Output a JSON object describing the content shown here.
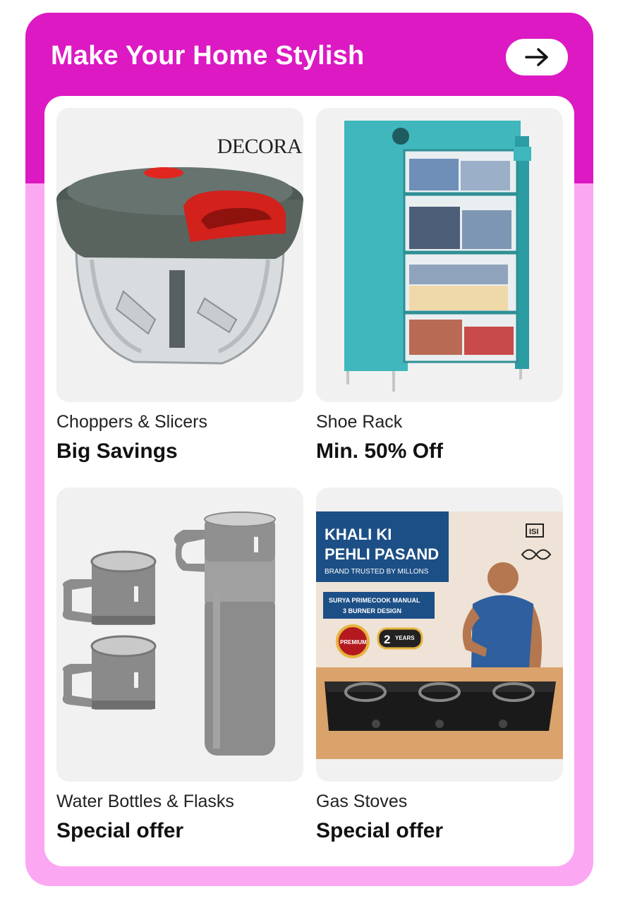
{
  "section": {
    "title": "Make Your Home Stylish",
    "arrow_icon": "arrow-right-icon"
  },
  "colors": {
    "header_bg": "#dc19c2",
    "card_bg": "#fca7f2",
    "panel_bg": "#ffffff"
  },
  "products": [
    {
      "category": "Choppers & Slicers",
      "offer": "Big Savings",
      "image": "vegetable-chopper-image",
      "image_brand": "DECORA"
    },
    {
      "category": "Shoe Rack",
      "offer": "Min. 50% Off",
      "image": "fabric-rack-image"
    },
    {
      "category": "Water Bottles & Flasks",
      "offer": "Special offer",
      "image": "flask-set-image"
    },
    {
      "category": "Gas Stoves",
      "offer": "Special offer",
      "image": "gas-stove-ad-image",
      "ad": {
        "headline_1": "KHALI KI",
        "headline_2": "PEHLI PASAND",
        "tagline": "BRAND TRUSTED BY MILLONS",
        "product_line_1": "SURYA PRIMECOOK MANUAL",
        "product_line_2": "3 BURNER DESIGN",
        "badge_1": "PREMIUM",
        "badge_2_num": "2",
        "badge_2_text": "YEARS",
        "cert_mark": "ISI"
      }
    }
  ]
}
